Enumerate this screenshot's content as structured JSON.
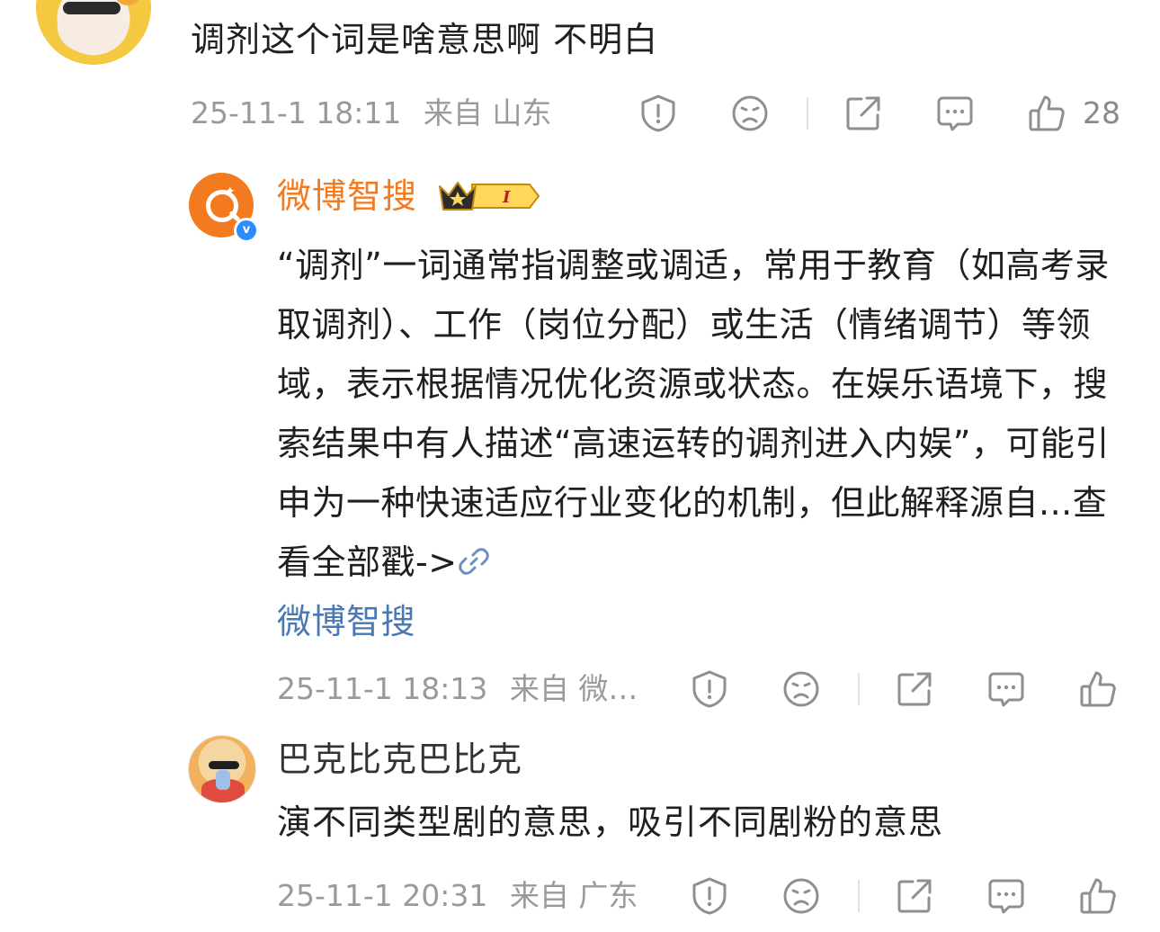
{
  "comments": [
    {
      "text": "调剂这个词是啥意思啊 不明白",
      "time": "25-11-1 18:11",
      "source": "来自 山东",
      "likes": "28"
    },
    {
      "username": "微博智搜",
      "badge_label": "I",
      "body": "“调剂”一词通常指调整或调适，常用于教育（如高考录取调剂）、工作（岗位分配）或生活（情绪调节）等领域，表示根据情况优化资源或状态。在娱乐语境下，搜索结果中有人描述“高速运转的调剂进入内娱”，可能引申为一种快速适应行业变化的机制，但此解释源自...查看全部戳->",
      "link_text": "微博智搜",
      "time": "25-11-1 18:13",
      "source": "来自 微…"
    },
    {
      "username": "巴克比克巴比克",
      "text": "演不同类型剧的意思，吸引不同剧粉的意思",
      "time": "25-11-1 20:31",
      "source": "来自 广东"
    }
  ],
  "colors": {
    "username_orange": "#f47a1f",
    "link_blue": "#4a77b5",
    "meta_gray": "#9a9a9a",
    "verified_blue": "#2a8cff"
  },
  "icons": [
    "report-icon",
    "dislike-icon",
    "share-icon",
    "reply-icon",
    "like-icon",
    "link-icon",
    "verified-icon",
    "crown-badge-icon"
  ]
}
